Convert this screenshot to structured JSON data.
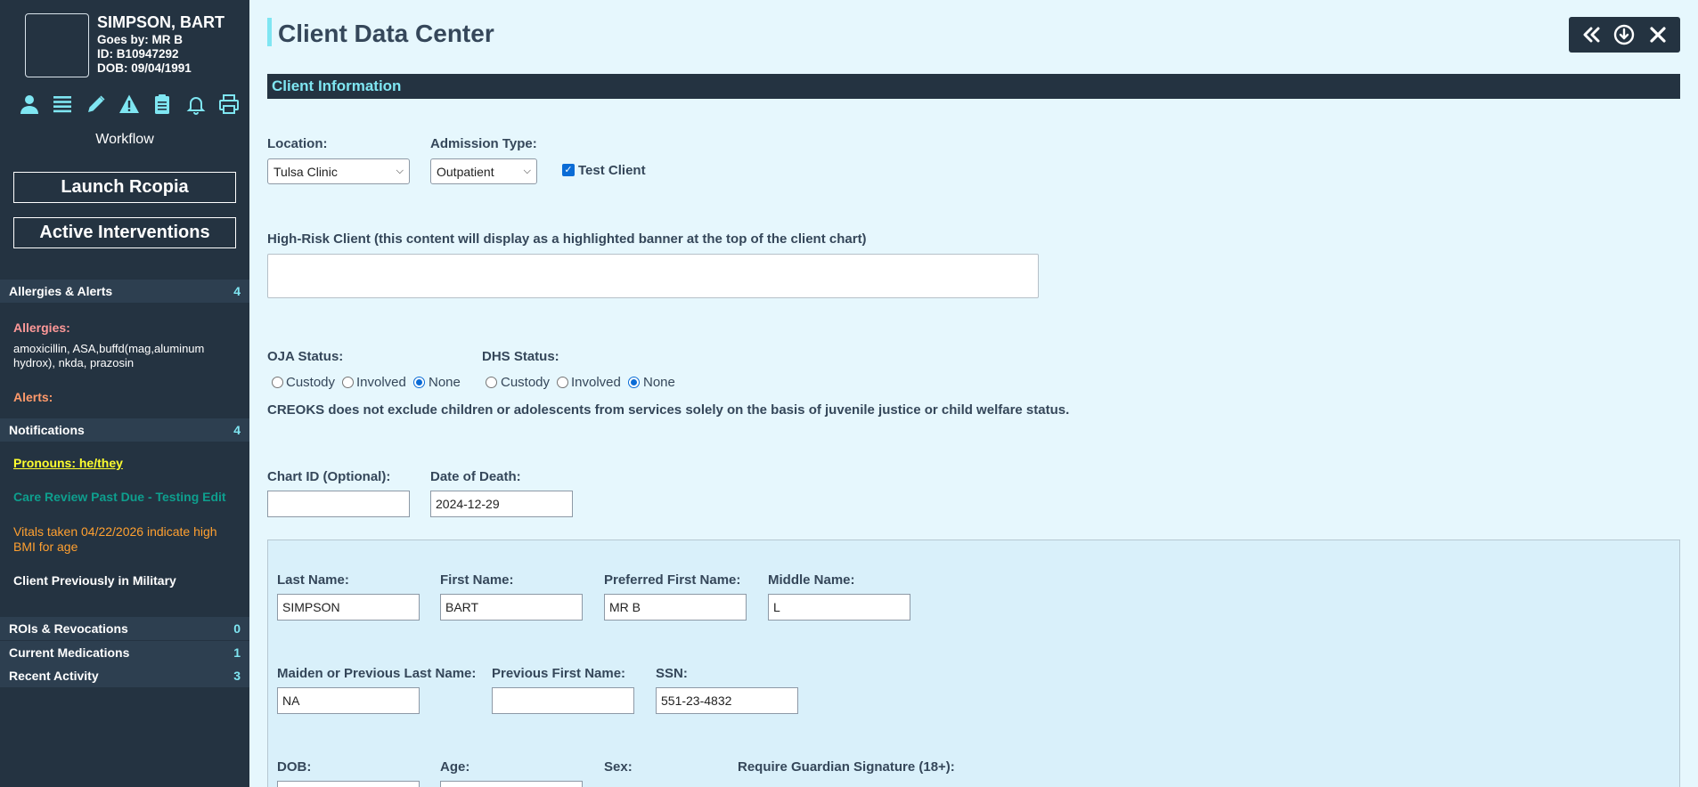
{
  "client": {
    "name": "SIMPSON, BART",
    "goes_by": "Goes by: MR B",
    "id": "ID: B10947292",
    "dob": "DOB: 09/04/1991"
  },
  "sidebar": {
    "icons": [
      "person-icon",
      "list-icon",
      "pencil-icon",
      "warning-icon",
      "clipboard-icon",
      "bell-icon",
      "printer-icon"
    ],
    "workflow": "Workflow",
    "launch_button": "Launch Rcopia",
    "interventions_button": "Active Interventions",
    "sections": {
      "allergies_alerts": {
        "label": "Allergies & Alerts",
        "count": "4"
      },
      "notifications": {
        "label": "Notifications",
        "count": "4"
      },
      "rois": {
        "label": "ROIs & Revocations",
        "count": "0"
      },
      "medications": {
        "label": "Current Medications",
        "count": "1"
      },
      "activity": {
        "label": "Recent Activity",
        "count": "3"
      }
    },
    "allergies_title": "Allergies:",
    "allergies_text": "amoxicillin, ASA,buffd(mag,aluminum hydrox), nkda, prazosin",
    "alerts_title": "Alerts:",
    "notifications": [
      "Pronouns: he/they",
      "Care Review Past Due - Testing Edit",
      "Vitals taken 04/22/2026 indicate high BMI for age",
      "Client Previously in Military"
    ]
  },
  "main": {
    "title": "Client Data Center",
    "section_title": "Client Information",
    "location": {
      "label": "Location:",
      "value": "Tulsa Clinic"
    },
    "admission": {
      "label": "Admission Type:",
      "value": "Outpatient"
    },
    "test_client": {
      "label": "Test Client",
      "checked": true
    },
    "high_risk_label": "High-Risk Client (this content will display as a highlighted banner at the top of the client chart)",
    "oja": {
      "label": "OJA Status:",
      "options": [
        "Custody",
        "Involved",
        "None"
      ],
      "selected": "None"
    },
    "dhs": {
      "label": "DHS Status:",
      "options": [
        "Custody",
        "Involved",
        "None"
      ],
      "selected": "None"
    },
    "note": "CREOKS does not exclude children or adolescents from services solely on the basis of juvenile justice or child welfare status.",
    "chart_id": {
      "label": "Chart ID (Optional):",
      "value": ""
    },
    "date_of_death": {
      "label": "Date of Death:",
      "value": "2024-12-29"
    },
    "last_name": {
      "label": "Last Name:",
      "value": "SIMPSON"
    },
    "first_name": {
      "label": "First Name:",
      "value": "BART"
    },
    "preferred_first_name": {
      "label": "Preferred First Name:",
      "value": "MR B"
    },
    "middle_name": {
      "label": "Middle Name:",
      "value": "L"
    },
    "maiden_name": {
      "label": "Maiden or Previous Last Name:",
      "value": "NA"
    },
    "previous_first_name": {
      "label": "Previous First Name:",
      "value": ""
    },
    "ssn": {
      "label": "SSN:",
      "value": "551-23-4832"
    },
    "dob": {
      "label": "DOB:"
    },
    "age": {
      "label": "Age:"
    },
    "sex": {
      "label": "Sex:"
    },
    "guardian": {
      "label": "Require Guardian Signature (18+):"
    }
  },
  "colors": {
    "sidebar_bg": "#243341",
    "accent": "#7fe6f2",
    "page_bg": "#e6f7fd"
  }
}
